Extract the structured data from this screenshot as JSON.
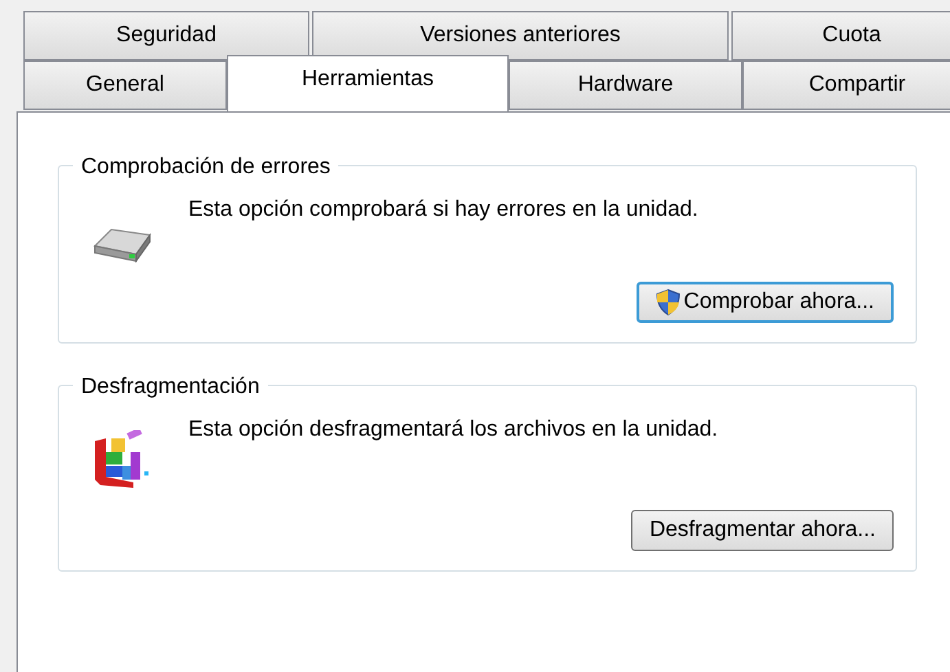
{
  "tab_rows": [
    {
      "tabs": [
        {
          "label": "Seguridad",
          "selected": false
        },
        {
          "label": "Versiones anteriores",
          "selected": false
        },
        {
          "label": "Cuota",
          "selected": false
        }
      ]
    },
    {
      "tabs": [
        {
          "label": "General",
          "selected": false
        },
        {
          "label": "Herramientas",
          "selected": true
        },
        {
          "label": "Hardware",
          "selected": false
        },
        {
          "label": "Compartir",
          "selected": false
        }
      ]
    }
  ],
  "groups": [
    {
      "kind": "check",
      "title": "Comprobación de errores",
      "text": "Esta opción comprobará si hay errores en la unidad.",
      "button": {
        "label": "Comprobar ahora...",
        "focused": true
      }
    },
    {
      "kind": "defrag",
      "title": "Desfragmentación",
      "text": "Esta opción desfragmentará los archivos en la unidad.",
      "button": {
        "label": "Desfragmentar ahora...",
        "focused": false
      }
    }
  ]
}
